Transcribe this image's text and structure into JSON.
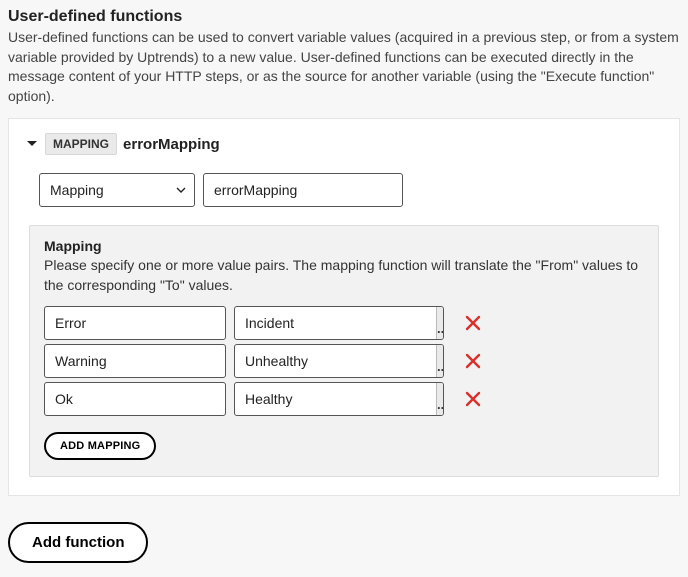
{
  "section": {
    "title": "User-defined functions",
    "description": "User-defined functions can be used to convert variable values (acquired in a previous step, or from a system variable provided by Uptrends) to a new value. User-defined functions can be executed directly in the message content of your HTTP steps, or as the source for another variable (using the \"Execute function\" option)."
  },
  "card": {
    "badge": "MAPPING",
    "name": "errorMapping",
    "type_select": "Mapping",
    "name_input": "errorMapping"
  },
  "mapping_box": {
    "title": "Mapping",
    "description": "Please specify one or more value pairs. The mapping function will translate the \"From\" values to the corresponding \"To\" values.",
    "rows": [
      {
        "from": "Error",
        "to": "Incident"
      },
      {
        "from": "Warning",
        "to": "Unhealthy"
      },
      {
        "from": "Ok",
        "to": "Healthy"
      }
    ],
    "ellipsis": "...",
    "add_mapping_label": "ADD MAPPING"
  },
  "add_function_label": "Add function"
}
